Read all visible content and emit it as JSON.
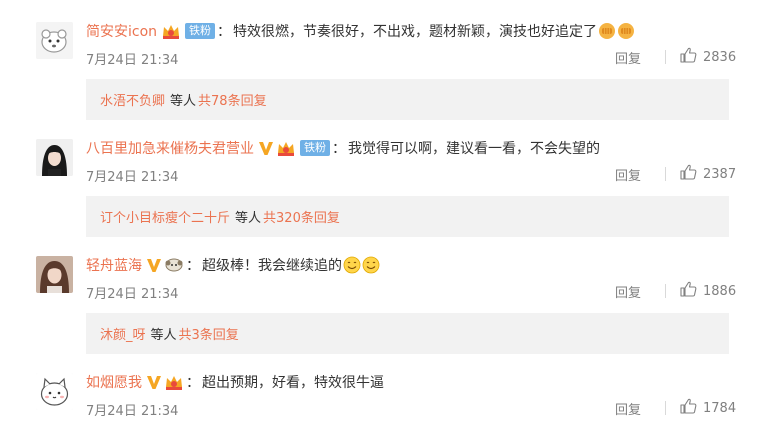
{
  "comments": [
    {
      "username": "简安安icon",
      "fan_badge": "铁粉",
      "text": "特效很燃，节奏很好，不出戏，题材新颖，演技也好追定了",
      "emojis": [
        "fist-emoji",
        "fist-emoji"
      ],
      "time": "7月24日 21:34",
      "reply_label": "回复",
      "likes": "2836",
      "sub": {
        "names": "水浯不负卿",
        "mid": "等人",
        "total": "共78条回复"
      }
    },
    {
      "username": "八百里加急来催杨夫君营业",
      "fan_badge": "铁粉",
      "text": "我觉得可以啊，建议看一看，不会失望的",
      "emojis": [],
      "time": "7月24日 21:34",
      "reply_label": "回复",
      "likes": "2387",
      "sub": {
        "names": "订个小目标瘦个二十斤",
        "mid": "等人",
        "total": "共320条回复"
      }
    },
    {
      "username": "轻舟蓝海",
      "fan_badge": "",
      "text": "超级棒！我会继续追的",
      "emojis": [
        "smile-emoji",
        "smile-emoji"
      ],
      "time": "7月24日 21:34",
      "reply_label": "回复",
      "likes": "1886",
      "sub": {
        "names": "沐颜_呀",
        "mid": "等人",
        "total": "共3条回复"
      }
    },
    {
      "username": "如烟愿我",
      "fan_badge": "",
      "text": "超出预期，好看，特效很牛逼",
      "emojis": [],
      "time": "7月24日 21:34",
      "reply_label": "回复",
      "likes": "1784",
      "sub": null
    }
  ],
  "colors": {
    "username": "#eb7350",
    "fan_badge_bg": "#6fb0e6",
    "verified_v": "#f5a623",
    "meta_gray": "#808080",
    "sub_bg": "#f2f2f2"
  },
  "icons": [
    "vip-crown-icon",
    "verified-v-icon",
    "fan-badge",
    "like-thumb-icon",
    "fist-emoji",
    "smile-emoji"
  ]
}
